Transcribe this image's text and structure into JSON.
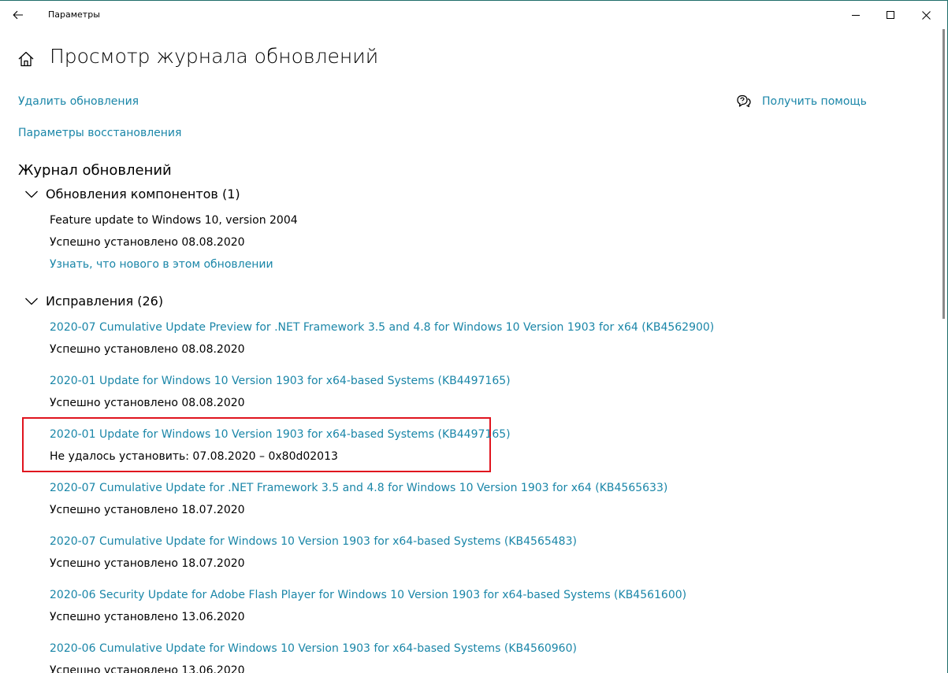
{
  "window": {
    "title": "Параметры"
  },
  "header": {
    "title": "Просмотр журнала обновлений"
  },
  "links": {
    "uninstall": "Удалить обновления",
    "recovery": "Параметры восстановления",
    "help": "Получить помощь"
  },
  "history": {
    "title": "Журнал обновлений",
    "feature_group": {
      "label": "Обновления компонентов (1)",
      "items": [
        {
          "name": "Feature update to Windows 10, version 2004",
          "status": "Успешно установлено 08.08.2020",
          "link": "Узнать, что нового в этом обновлении"
        }
      ]
    },
    "quality_group": {
      "label": "Исправления (26)",
      "items": [
        {
          "name": "2020-07 Cumulative Update Preview for .NET Framework 3.5 and 4.8 for Windows 10 Version 1903 for x64 (KB4562900)",
          "status": "Успешно установлено 08.08.2020"
        },
        {
          "name": "2020-01 Update for Windows 10 Version 1903 for x64-based Systems (KB4497165)",
          "status": "Успешно установлено 08.08.2020"
        },
        {
          "name": "2020-01 Update for Windows 10 Version 1903 for x64-based Systems (KB4497165)",
          "status": "Не удалось установить: 07.08.2020 – 0x80d02013"
        },
        {
          "name": "2020-07 Cumulative Update for .NET Framework 3.5 and 4.8 for Windows 10 Version 1903 for x64 (KB4565633)",
          "status": "Успешно установлено 18.07.2020"
        },
        {
          "name": "2020-07 Cumulative Update for Windows 10 Version 1903 for x64-based Systems (KB4565483)",
          "status": "Успешно установлено 18.07.2020"
        },
        {
          "name": "2020-06 Security Update for Adobe Flash Player for Windows 10 Version 1903 for x64-based Systems (KB4561600)",
          "status": "Успешно установлено 13.06.2020"
        },
        {
          "name": "2020-06 Cumulative Update for Windows 10 Version 1903 for x64-based Systems (KB4560960)",
          "status": "Успешно установлено 13.06.2020"
        }
      ]
    }
  },
  "colors": {
    "link": "#1a86a8",
    "highlight": "#e0141e"
  },
  "icons": {
    "back": "back-arrow-icon",
    "home": "home-icon",
    "help": "chat-help-icon",
    "chevron": "chevron-down-icon"
  }
}
